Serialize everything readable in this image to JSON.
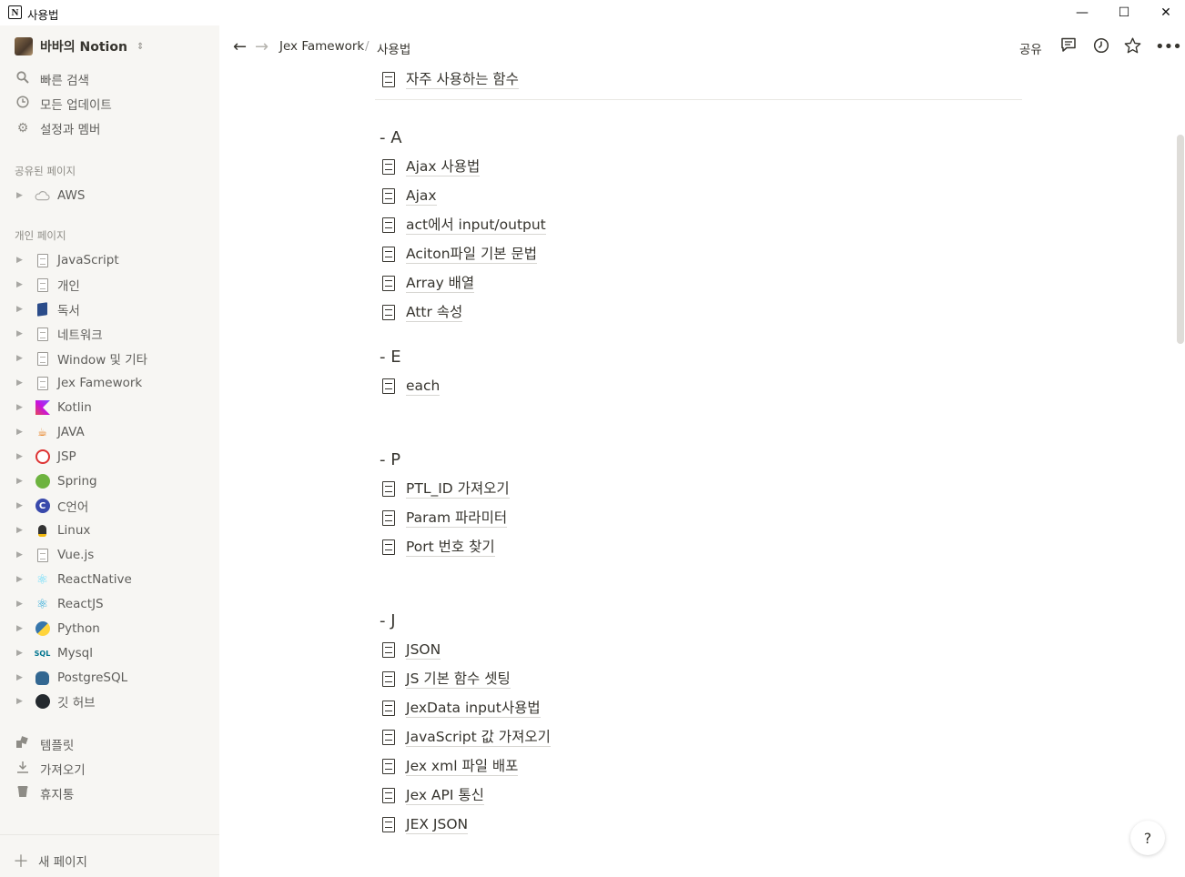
{
  "window": {
    "title": "사용법",
    "minimize": "—",
    "maximize": "☐",
    "close": "✕"
  },
  "sidebar": {
    "workspace_name": "바바의 Notion",
    "nav": [
      {
        "label": "빠른 검색",
        "icon": "search-icon"
      },
      {
        "label": "모든 업데이트",
        "icon": "clock-icon"
      },
      {
        "label": "설정과 멤버",
        "icon": "gear-icon"
      }
    ],
    "shared_label": "공유된 페이지",
    "shared": [
      {
        "label": "AWS",
        "icon": "cloud-icon"
      }
    ],
    "private_label": "개인 페이지",
    "private": [
      {
        "label": "JavaScript",
        "icon": "page-icon"
      },
      {
        "label": "개인",
        "icon": "page-icon"
      },
      {
        "label": "독서",
        "icon": "book-icon"
      },
      {
        "label": "네트워크",
        "icon": "page-icon"
      },
      {
        "label": "Window 및 기타",
        "icon": "page-icon"
      },
      {
        "label": "Jex Famework",
        "icon": "page-icon"
      },
      {
        "label": "Kotlin",
        "icon": "kotlin-icon"
      },
      {
        "label": "JAVA",
        "icon": "java-icon"
      },
      {
        "label": "JSP",
        "icon": "jsp-icon"
      },
      {
        "label": "Spring",
        "icon": "spring-icon"
      },
      {
        "label": "C언어",
        "icon": "c-lang-icon"
      },
      {
        "label": "Linux",
        "icon": "linux-icon"
      },
      {
        "label": "Vue.js",
        "icon": "page-icon"
      },
      {
        "label": "ReactNative",
        "icon": "react-native-icon"
      },
      {
        "label": "ReactJS",
        "icon": "react-icon"
      },
      {
        "label": "Python",
        "icon": "python-icon"
      },
      {
        "label": "Mysql",
        "icon": "mysql-icon"
      },
      {
        "label": "PostgreSQL",
        "icon": "postgresql-icon"
      },
      {
        "label": "깃 허브",
        "icon": "github-icon"
      }
    ],
    "bottom": [
      {
        "label": "템플릿",
        "icon": "template-icon"
      },
      {
        "label": "가져오기",
        "icon": "download-icon"
      },
      {
        "label": "휴지통",
        "icon": "trash-icon"
      }
    ],
    "new_page": "새 페이지"
  },
  "topbar": {
    "breadcrumb": [
      "Jex Famework",
      "사용법"
    ],
    "separator": "/",
    "share": "공유"
  },
  "main": {
    "top_page": "자주 사용하는 함수",
    "groups": [
      {
        "heading": "- A",
        "pages": [
          "Ajax 사용법",
          "Ajax",
          "act에서 input/output",
          "Aciton파일 기본 문법",
          "Array 배열",
          "Attr 속성"
        ]
      },
      {
        "heading": "- E",
        "pages": [
          "each"
        ]
      },
      {
        "heading": "- P",
        "pages": [
          "PTL_ID 가져오기",
          "Param 파라미터",
          "Port 번호 찾기"
        ]
      },
      {
        "heading": "- J",
        "pages": [
          "JSON",
          "JS 기본 함수 셋팅",
          "JexData input사용법",
          "JavaScript 값 가져오기",
          "Jex xml 파일 배포",
          "Jex API 통신",
          "JEX JSON"
        ]
      }
    ]
  },
  "help": "?"
}
